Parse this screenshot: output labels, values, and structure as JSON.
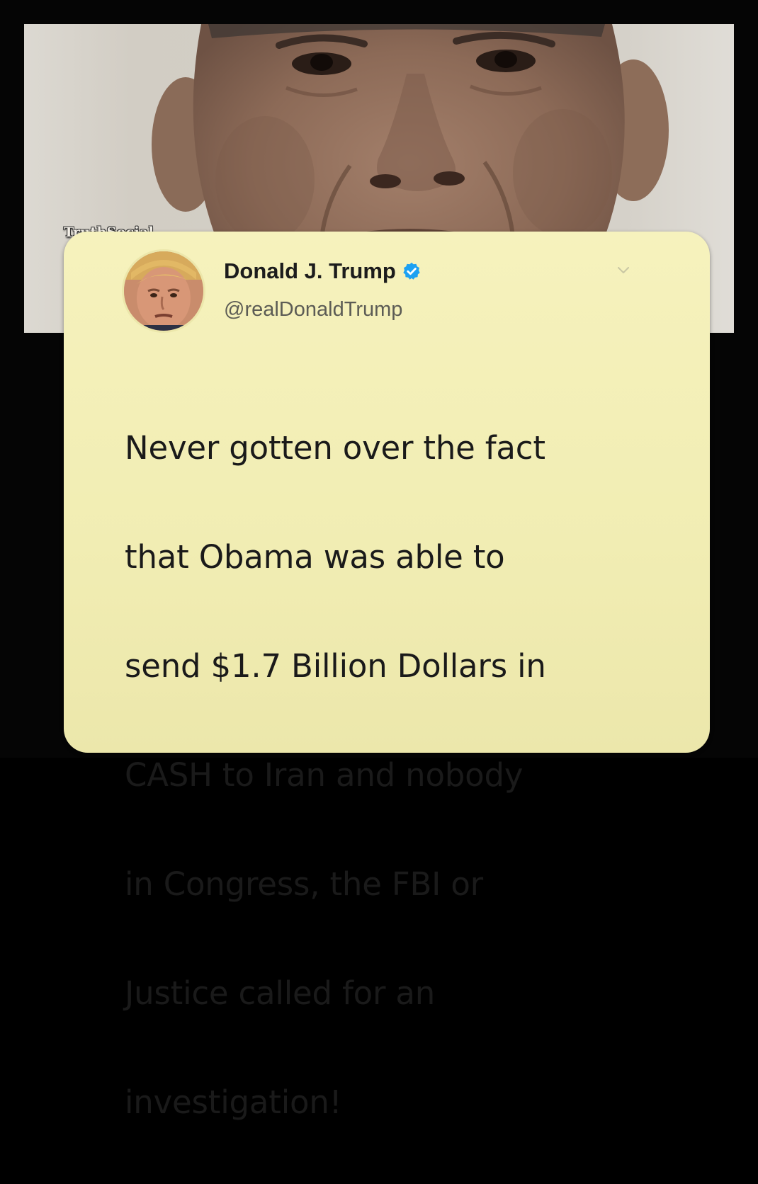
{
  "watermark": {
    "text": "TruthSocial"
  },
  "tweet": {
    "author_name": "Donald J. Trump",
    "handle": "@realDonaldTrump",
    "verified_icon": "verified-badge-icon",
    "menu_icon": "chevron-down-icon",
    "text_lines": [
      "Never gotten over the fact",
      "that Obama was able to",
      "send $1.7 Billion Dollars in",
      "CASH to Iran and nobody",
      "in Congress, the FBI or",
      "Justice called for an",
      "investigation!"
    ]
  },
  "colors": {
    "card_background": "#f3efb6",
    "verified_blue": "#1da1f2",
    "frame": "#050505"
  }
}
